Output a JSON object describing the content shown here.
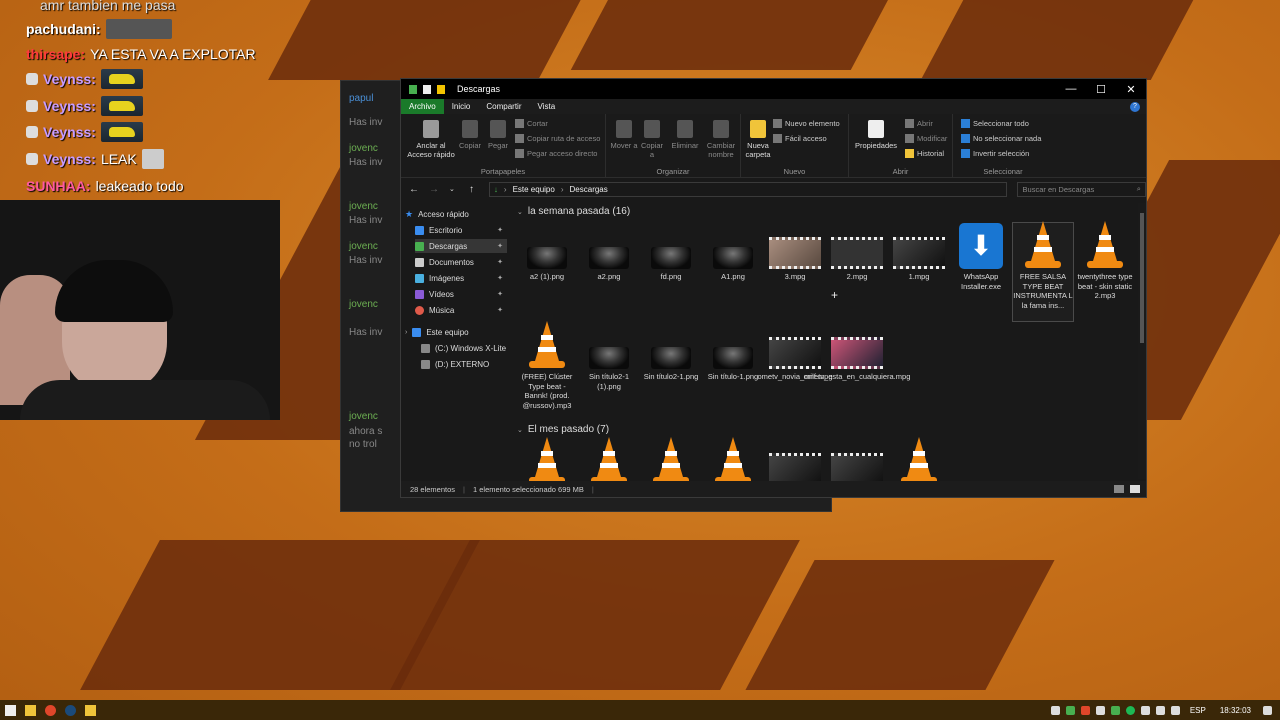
{
  "chat": {
    "lines": [
      {
        "user": "pachudani:",
        "user_color": "#ffffff",
        "text": ""
      },
      {
        "user": "thirsape:",
        "user_color": "#ff3b3b",
        "text": "YA ESTA VA A EXPLOTAR"
      },
      {
        "user": "Veynss:",
        "user_color": "#c79bff",
        "text": ""
      },
      {
        "user": "Veynss:",
        "user_color": "#c79bff",
        "text": ""
      },
      {
        "user": "Veynss:",
        "user_color": "#c79bff",
        "text": ""
      },
      {
        "user": "Veynss:",
        "user_color": "#c79bff",
        "text": "LEAK"
      },
      {
        "user": "SUNHAA:",
        "user_color": "#ff5aa0",
        "text": "leakeado todo"
      }
    ],
    "top_partial": "amr tambien me pasa"
  },
  "bgwin": {
    "entries": [
      {
        "name": "papul",
        "text": "Has inv"
      },
      {
        "name": "jovenc",
        "text": "Has inv"
      },
      {
        "name": "jovenc",
        "text": "Has inv"
      },
      {
        "name": "jovenc",
        "text": "Has inv"
      },
      {
        "name": "jovenc",
        "text": "Has inv"
      },
      {
        "name": "jovenc",
        "text": "ahora s"
      }
    ],
    "tail": "no trol"
  },
  "explorer": {
    "title": "Descargas",
    "window_controls": {
      "min": "—",
      "max": "☐",
      "close": "✕"
    },
    "menu": {
      "file": "Archivo",
      "home": "Inicio",
      "share": "Compartir",
      "view": "Vista",
      "help": "?"
    },
    "ribbon": {
      "clipboard": {
        "label": "Portapapeles",
        "pin": "Anclar al Acceso rápido",
        "copy": "Copiar",
        "paste": "Pegar",
        "cut": "Cortar",
        "copy_path": "Copiar ruta de acceso",
        "paste_link": "Pegar acceso directo"
      },
      "organize": {
        "label": "Organizar",
        "move": "Mover a",
        "copy_to": "Copiar a",
        "delete": "Eliminar",
        "rename": "Cambiar nombre"
      },
      "new": {
        "label": "Nuevo",
        "new_folder": "Nueva carpeta",
        "new_item": "Nuevo elemento",
        "easy_access": "Fácil acceso"
      },
      "open": {
        "label": "Abrir",
        "properties": "Propiedades",
        "open": "Abrir",
        "edit": "Modificar",
        "history": "Historial"
      },
      "select": {
        "label": "Seleccionar",
        "all": "Seleccionar todo",
        "none": "No seleccionar nada",
        "invert": "Invertir selección"
      }
    },
    "address": {
      "root": "Este equipo",
      "folder": "Descargas",
      "search_placeholder": "Buscar en Descargas"
    },
    "nav": {
      "quick_access": "Acceso rápido",
      "items": [
        "Escritorio",
        "Descargas",
        "Documentos",
        "Imágenes",
        "Vídeos",
        "Música"
      ],
      "this_pc": "Este equipo",
      "drives": [
        "(C:) Windows X-Lite",
        "(D:) EXTERNO"
      ]
    },
    "groups": [
      {
        "label": "la semana pasada (16)"
      },
      {
        "label": "El mes pasado (7)"
      }
    ],
    "files_week": [
      {
        "name": "a2 (1).png",
        "kind": "photo"
      },
      {
        "name": "a2.png",
        "kind": "photo"
      },
      {
        "name": "fd.png",
        "kind": "photo"
      },
      {
        "name": "A1.png",
        "kind": "photo"
      },
      {
        "name": "3.mpg",
        "kind": "video-warm"
      },
      {
        "name": "2.mpg",
        "kind": "video"
      },
      {
        "name": "1.mpg",
        "kind": "video-dark"
      },
      {
        "name": "WhatsApp Installer.exe",
        "kind": "whatsapp"
      },
      {
        "name": "FREE SALSA TYPE BEAT INSTRUMENTA L la fama ins...",
        "kind": "vlc"
      },
      {
        "name": "twentythree type beat - skin static 2.mp3",
        "kind": "vlc"
      },
      {
        "name": "(FREE) Clúster Type beat - Bannk! (prod. @russov).mp3",
        "kind": "vlc"
      },
      {
        "name": "Sin título2-1 (1).png",
        "kind": "photo"
      },
      {
        "name": "Sin título2-1.png",
        "kind": "photo"
      },
      {
        "name": "Sin título-1.png",
        "kind": "photo"
      },
      {
        "name": "ometv_novia_milf.mpg",
        "kind": "video-dark"
      },
      {
        "name": "ometv_esta_en_cualquiera.mpg",
        "kind": "vid2"
      }
    ],
    "status": {
      "count": "28 elementos",
      "selection": "1 elemento seleccionado 699 MB"
    }
  },
  "taskbar": {
    "lang": "ESP",
    "time": "18:32:03"
  },
  "colors": {
    "explorer_bg": "#191919",
    "ribbon_active": "#1a7a2a",
    "vlc_orange": "#f08a12",
    "taskbar": "#3a2708"
  }
}
